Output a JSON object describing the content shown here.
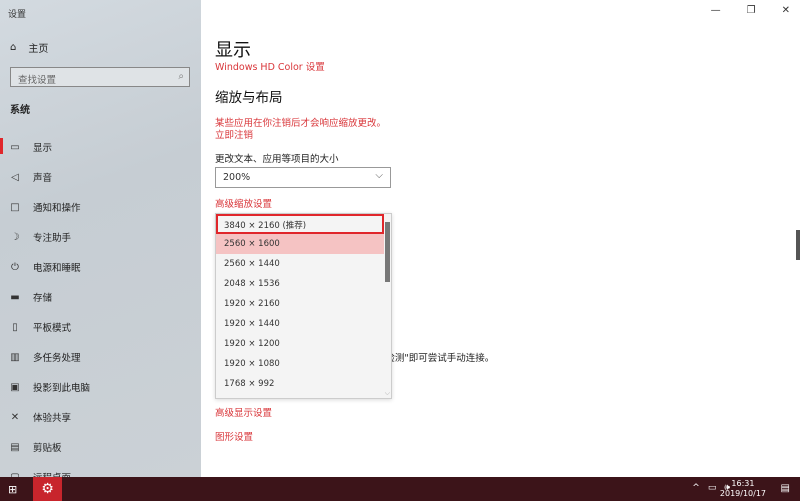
{
  "app_title": "设置",
  "sidebar": {
    "home": "主页",
    "search_placeholder": "查找设置",
    "section": "系统",
    "items": [
      {
        "label": "显示",
        "icon": "monitor-icon",
        "active": true
      },
      {
        "label": "声音",
        "icon": "speaker-icon"
      },
      {
        "label": "通知和操作",
        "icon": "notification-icon"
      },
      {
        "label": "专注助手",
        "icon": "moon-icon"
      },
      {
        "label": "电源和睡眠",
        "icon": "power-icon"
      },
      {
        "label": "存储",
        "icon": "storage-icon"
      },
      {
        "label": "平板模式",
        "icon": "tablet-icon"
      },
      {
        "label": "多任务处理",
        "icon": "multitask-icon"
      },
      {
        "label": "投影到此电脑",
        "icon": "project-icon"
      },
      {
        "label": "体验共享",
        "icon": "share-icon"
      },
      {
        "label": "剪贴板",
        "icon": "clipboard-icon"
      },
      {
        "label": "远程桌面",
        "icon": "remote-icon"
      }
    ]
  },
  "main": {
    "title": "显示",
    "hd_color_link": "Windows HD Color 设置",
    "scale_heading": "缩放与布局",
    "warning": "某些应用在你注销后才会响应缩放更改。",
    "signout_link": "立即注销",
    "scale_label": "更改文本、应用等项目的大小",
    "scale_value": "200%",
    "advanced_scaling_link": "高级缩放设置",
    "resolution_options": [
      "3840 × 2160 (推荐)",
      "2560 × 1600",
      "2560 × 1440",
      "2048 × 1536",
      "1920 × 2160",
      "1920 × 1440",
      "1920 × 1200",
      "1920 × 1080",
      "1768 × 992"
    ],
    "selected_resolution": "3840 × 2160 (推荐)",
    "hovered_resolution": "2560 × 1600",
    "partial_text": "\"检测\"即可尝试手动连接。",
    "advanced_display_link": "高级显示设置",
    "graphics_link": "图形设置"
  },
  "taskbar": {
    "time": "16:31",
    "date": "2019/10/17"
  },
  "colors": {
    "accent": "#e0262b",
    "taskbar": "#3c1419"
  }
}
